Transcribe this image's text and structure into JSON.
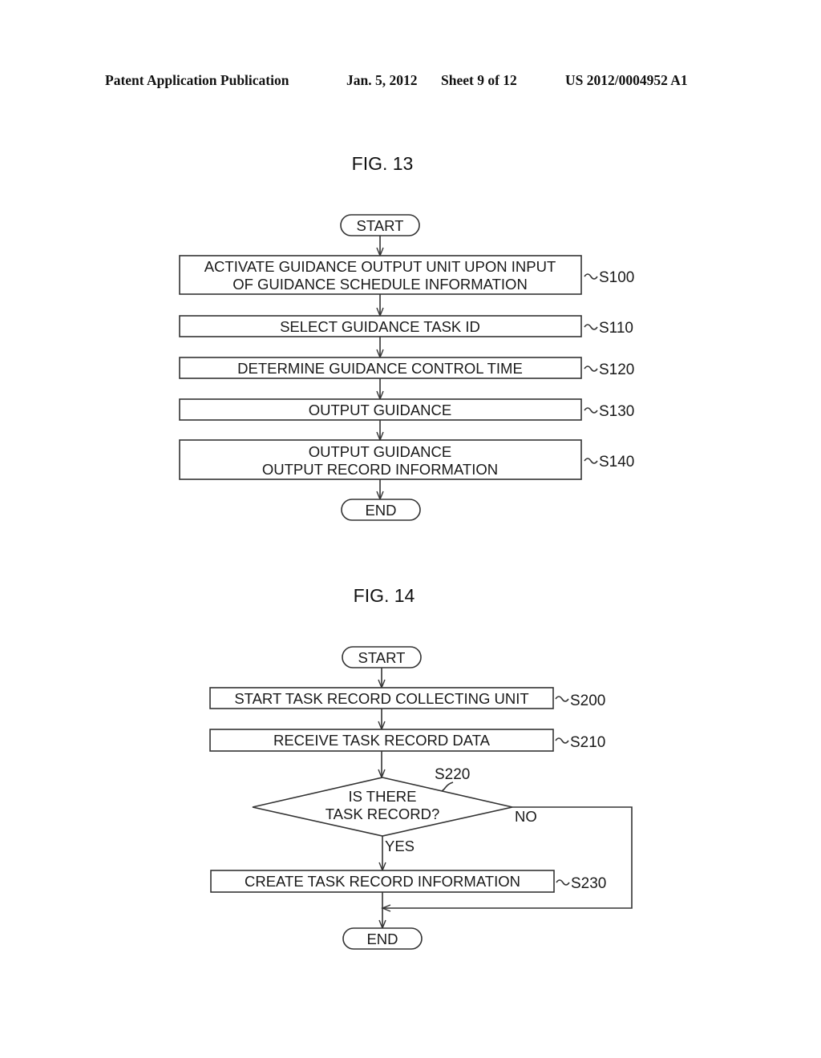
{
  "header": {
    "publication": "Patent Application Publication",
    "date": "Jan. 5, 2012",
    "sheet": "Sheet 9 of 12",
    "number": "US 2012/0004952 A1"
  },
  "fig13": {
    "title": "FIG. 13",
    "start": "START",
    "end": "END",
    "steps": [
      {
        "id": "S100",
        "lines": [
          "ACTIVATE GUIDANCE OUTPUT UNIT UPON INPUT",
          "OF GUIDANCE SCHEDULE INFORMATION"
        ]
      },
      {
        "id": "S110",
        "lines": [
          "SELECT GUIDANCE TASK ID"
        ]
      },
      {
        "id": "S120",
        "lines": [
          "DETERMINE GUIDANCE CONTROL TIME"
        ]
      },
      {
        "id": "S130",
        "lines": [
          "OUTPUT GUIDANCE"
        ]
      },
      {
        "id": "S140",
        "lines": [
          "OUTPUT GUIDANCE",
          "OUTPUT RECORD INFORMATION"
        ]
      }
    ]
  },
  "fig14": {
    "title": "FIG. 14",
    "start": "START",
    "end": "END",
    "steps": [
      {
        "id": "S200",
        "lines": [
          "START TASK RECORD COLLECTING UNIT"
        ]
      },
      {
        "id": "S210",
        "lines": [
          "RECEIVE TASK RECORD DATA"
        ]
      }
    ],
    "decision": {
      "id": "S220",
      "lines": [
        "IS THERE",
        "TASK RECORD?"
      ],
      "yes": "YES",
      "no": "NO"
    },
    "after_yes": {
      "id": "S230",
      "lines": [
        "CREATE TASK RECORD INFORMATION"
      ]
    }
  }
}
